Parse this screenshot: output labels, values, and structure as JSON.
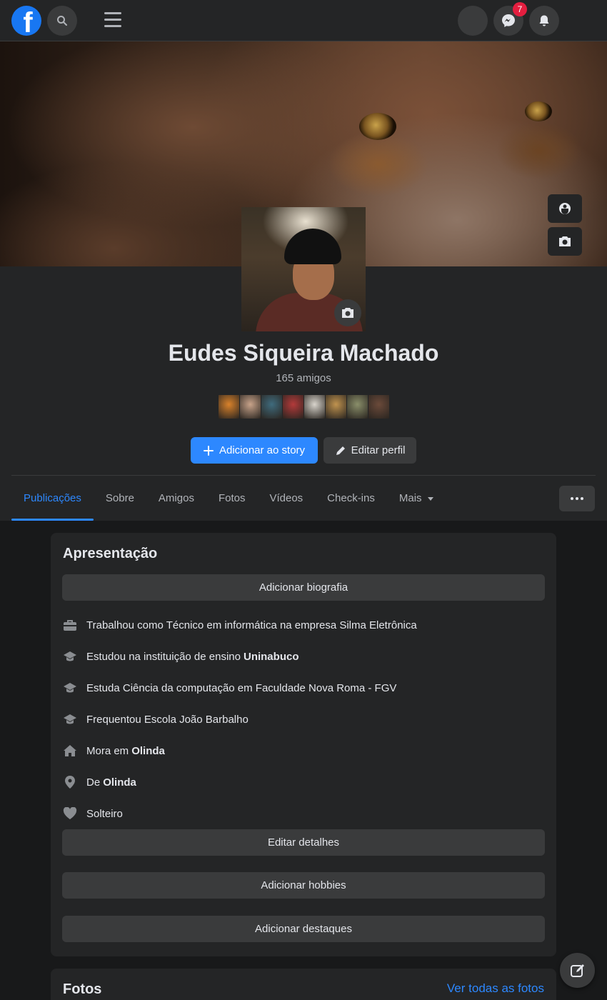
{
  "topbar": {
    "messenger_badge": "7"
  },
  "profile": {
    "name": "Eudes Siqueira Machado",
    "friends_count": "165 amigos",
    "friend_thumb_colors": [
      "#d9822b",
      "#c8a38a",
      "#3f6b7d",
      "#b33a3a",
      "#d8d4cc",
      "#c0934f",
      "#8a8f6a",
      "#6b4a3a"
    ]
  },
  "actions": {
    "add_story": "Adicionar ao story",
    "edit_profile": "Editar perfil"
  },
  "tabs": [
    "Publicações",
    "Sobre",
    "Amigos",
    "Fotos",
    "Vídeos",
    "Check-ins",
    "Mais"
  ],
  "intro": {
    "title": "Apresentação",
    "add_bio": "Adicionar biografia",
    "details": [
      {
        "icon": "briefcase-icon",
        "text": "Trabalhou como Técnico em informática na empresa Silma Eletrônica",
        "bold": ""
      },
      {
        "icon": "graduation-cap-icon",
        "text": "Estudou na instituição de ensino",
        "bold": "Uninabuco"
      },
      {
        "icon": "graduation-cap-icon",
        "text": "Estuda Ciência da computação em Faculdade Nova Roma - FGV",
        "bold": ""
      },
      {
        "icon": "graduation-cap-icon",
        "text": "Frequentou Escola João Barbalho",
        "bold": ""
      },
      {
        "icon": "home-icon",
        "text": "Mora em",
        "bold": "Olinda"
      },
      {
        "icon": "location-pin-icon",
        "text": "De",
        "bold": "Olinda"
      },
      {
        "icon": "heart-icon",
        "text": "Solteiro",
        "bold": ""
      }
    ],
    "edit_details": "Editar detalhes",
    "add_hobbies": "Adicionar hobbies",
    "add_highlights": "Adicionar destaques"
  },
  "photos": {
    "title": "Fotos",
    "see_all": "Ver todas as fotos"
  },
  "colors": {
    "accent": "#2d88ff",
    "background": "#18191a",
    "surface": "#242526",
    "badge": "#e41e3f"
  }
}
